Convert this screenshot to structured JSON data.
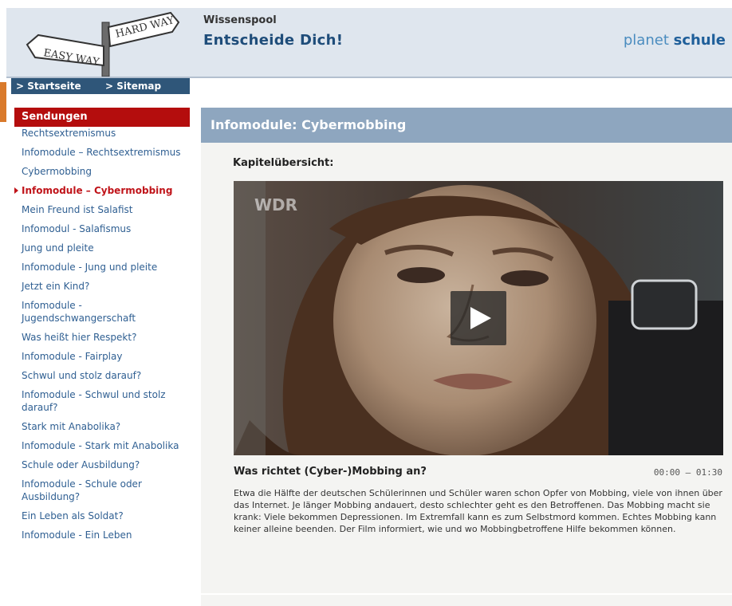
{
  "header": {
    "kicker": "Wissenspool",
    "title": "Entscheide Dich!",
    "brand_plain": "planet",
    "brand_bold": "schule",
    "logo_sign_top": "HARD WAY",
    "logo_sign_bottom": "EASY WAY"
  },
  "nav": {
    "home": "> Startseite",
    "sitemap": "> Sitemap"
  },
  "sidebar": {
    "heading": "Sendungen",
    "items": [
      {
        "label": "Rechtsextremismus"
      },
      {
        "label": "Infomodule – Rechtsextremismus"
      },
      {
        "label": "Cybermobbing"
      },
      {
        "label": "Infomodule – Cybermobbing",
        "active": true
      },
      {
        "label": "Mein Freund ist Salafist"
      },
      {
        "label": "Infomodul - Salafismus"
      },
      {
        "label": "Jung und pleite"
      },
      {
        "label": "Infomodule - Jung und pleite"
      },
      {
        "label": "Jetzt ein Kind?"
      },
      {
        "label": "Infomodule - Jugendschwangerschaft"
      },
      {
        "label": "Was heißt hier Respekt?"
      },
      {
        "label": "Infomodule - Fairplay"
      },
      {
        "label": "Schwul und stolz darauf?"
      },
      {
        "label": "Infomodule - Schwul und stolz darauf?"
      },
      {
        "label": "Stark mit Anabolika?"
      },
      {
        "label": "Infomodule - Stark mit Anabolika"
      },
      {
        "label": "Schule oder Ausbildung?"
      },
      {
        "label": "Infomodule - Schule oder Ausbildung?"
      },
      {
        "label": "Ein Leben als Soldat?"
      },
      {
        "label": "Infomodule - Ein Leben"
      }
    ]
  },
  "main": {
    "heading": "Infomodule: Cybermobbing",
    "section_label": "Kapitelübersicht:",
    "video": {
      "watermark": "WDR",
      "play_icon": "play-icon"
    },
    "chapter": {
      "title": "Was richtet (Cyber-)Mobbing an?",
      "time": "00:00 – 01:30",
      "description": "Etwa die Hälfte der deutschen Schülerinnen und Schüler waren schon Opfer von Mobbing, viele von ihnen über das Internet. Je länger Mobbing andauert, desto schlechter geht es den Betroffenen. Das Mobbing macht sie krank: Viele bekommen Depressionen. Im Extremfall kann es zum Selbstmord kommen. Echtes Mobbing kann keiner alleine beenden. Der Film informiert, wie und wo Mobbingbetroffene Hilfe bekommen können."
    }
  },
  "colors": {
    "sidebar_heading": "#b40d0d",
    "nav_bar": "#2f5679",
    "main_heading": "#8ea6bf",
    "link": "#2f5f92",
    "active": "#c0141a"
  }
}
